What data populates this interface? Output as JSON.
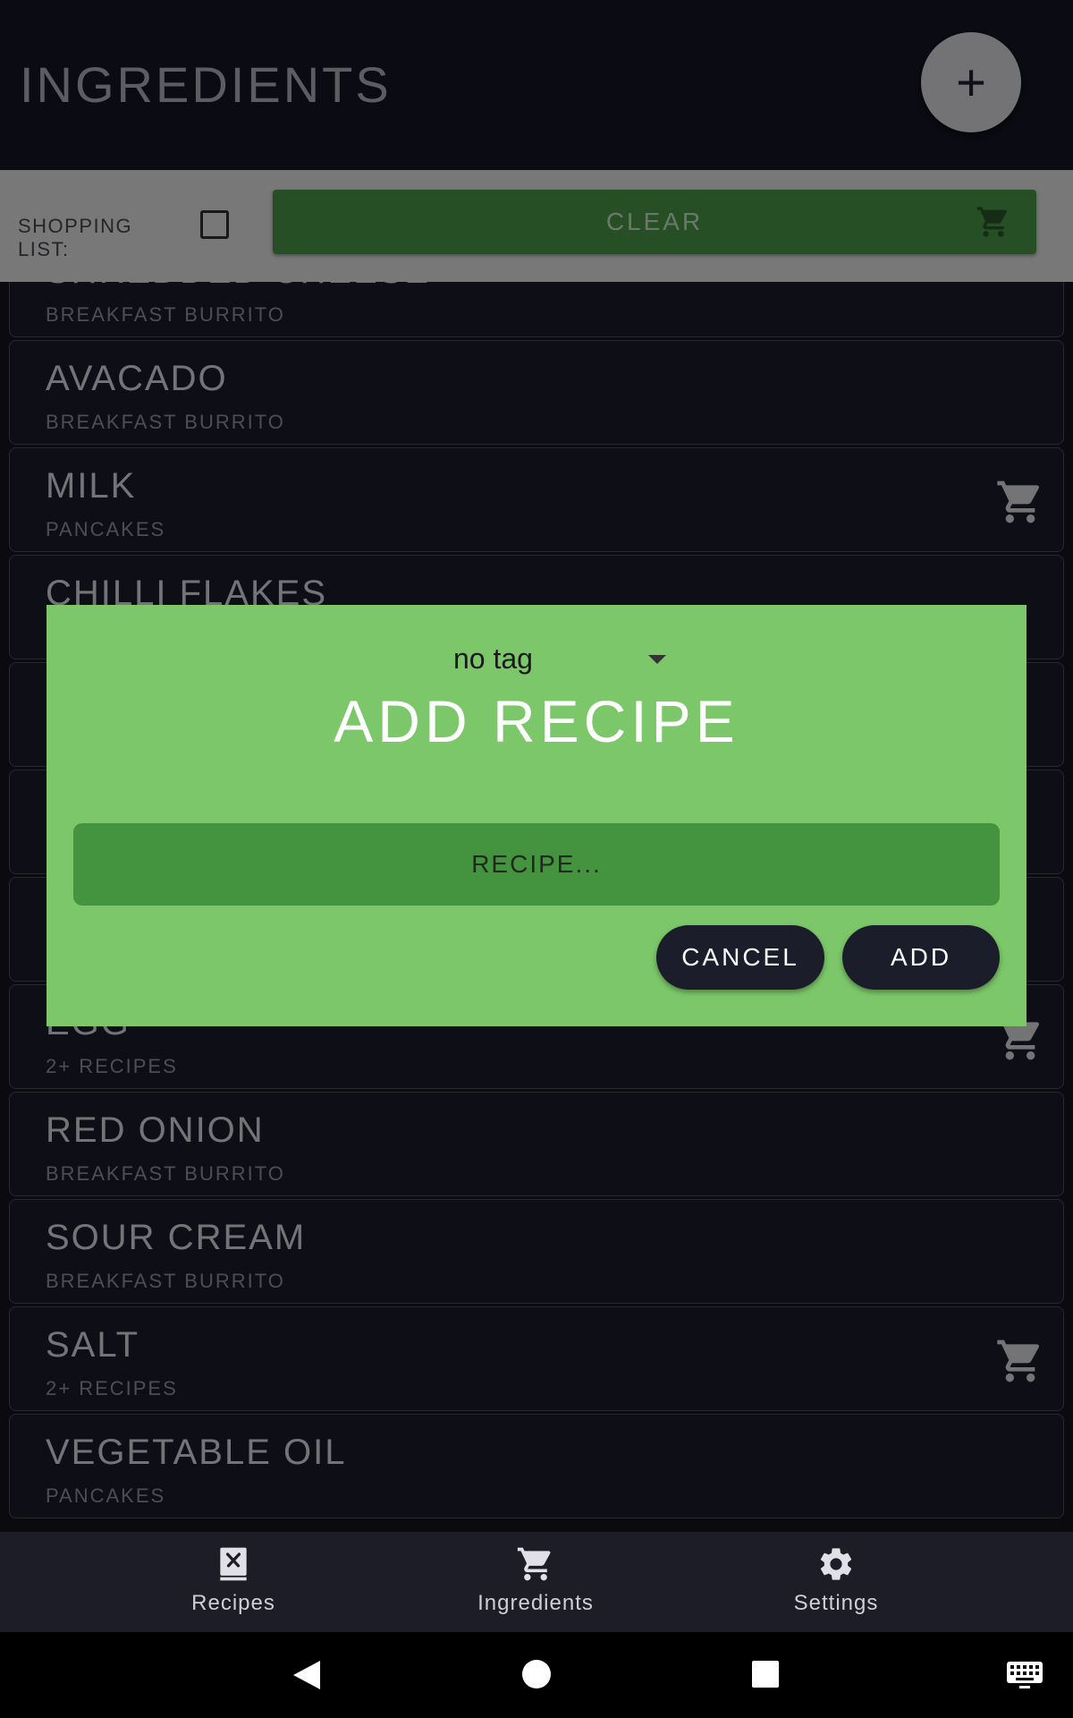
{
  "header": {
    "title": "INGREDIENTS",
    "fab_label": "+"
  },
  "toolbar": {
    "shopping_list_label": "SHOPPING LIST:",
    "clear_label": "CLEAR"
  },
  "ingredients": [
    {
      "name": "SHREDDED CHEESE",
      "recipe": "BREAKFAST BURRITO",
      "in_cart": false
    },
    {
      "name": "AVACADO",
      "recipe": "BREAKFAST BURRITO",
      "in_cart": false
    },
    {
      "name": "MILK",
      "recipe": "PANCAKES",
      "in_cart": true
    },
    {
      "name": "CHILLI FLAKES",
      "recipe": "",
      "in_cart": false
    },
    {
      "name": "",
      "recipe": "",
      "in_cart": false
    },
    {
      "name": "",
      "recipe": "",
      "in_cart": false
    },
    {
      "name": "",
      "recipe": "",
      "in_cart": false
    },
    {
      "name": "EGG",
      "recipe": "2+ RECIPES",
      "in_cart": true
    },
    {
      "name": "RED ONION",
      "recipe": "BREAKFAST BURRITO",
      "in_cart": false
    },
    {
      "name": "SOUR CREAM",
      "recipe": "BREAKFAST BURRITO",
      "in_cart": false
    },
    {
      "name": "SALT",
      "recipe": "2+ RECIPES",
      "in_cart": true
    },
    {
      "name": "VEGETABLE OIL",
      "recipe": "PANCAKES",
      "in_cart": false
    }
  ],
  "dialog": {
    "tag_value": "no tag",
    "title": "ADD RECIPE",
    "input_placeholder": "RECIPE...",
    "cancel_label": "CANCEL",
    "add_label": "ADD"
  },
  "bottom_nav": [
    {
      "label": "Recipes",
      "icon": "recipe-book-icon"
    },
    {
      "label": "Ingredients",
      "icon": "cart-icon"
    },
    {
      "label": "Settings",
      "icon": "gear-icon"
    }
  ],
  "colors": {
    "background": "#14151f",
    "accent_green": "#4e9e4a",
    "dialog_green": "#7cc76a",
    "input_green": "#43933f",
    "pill_dark": "#1b1d2b"
  }
}
